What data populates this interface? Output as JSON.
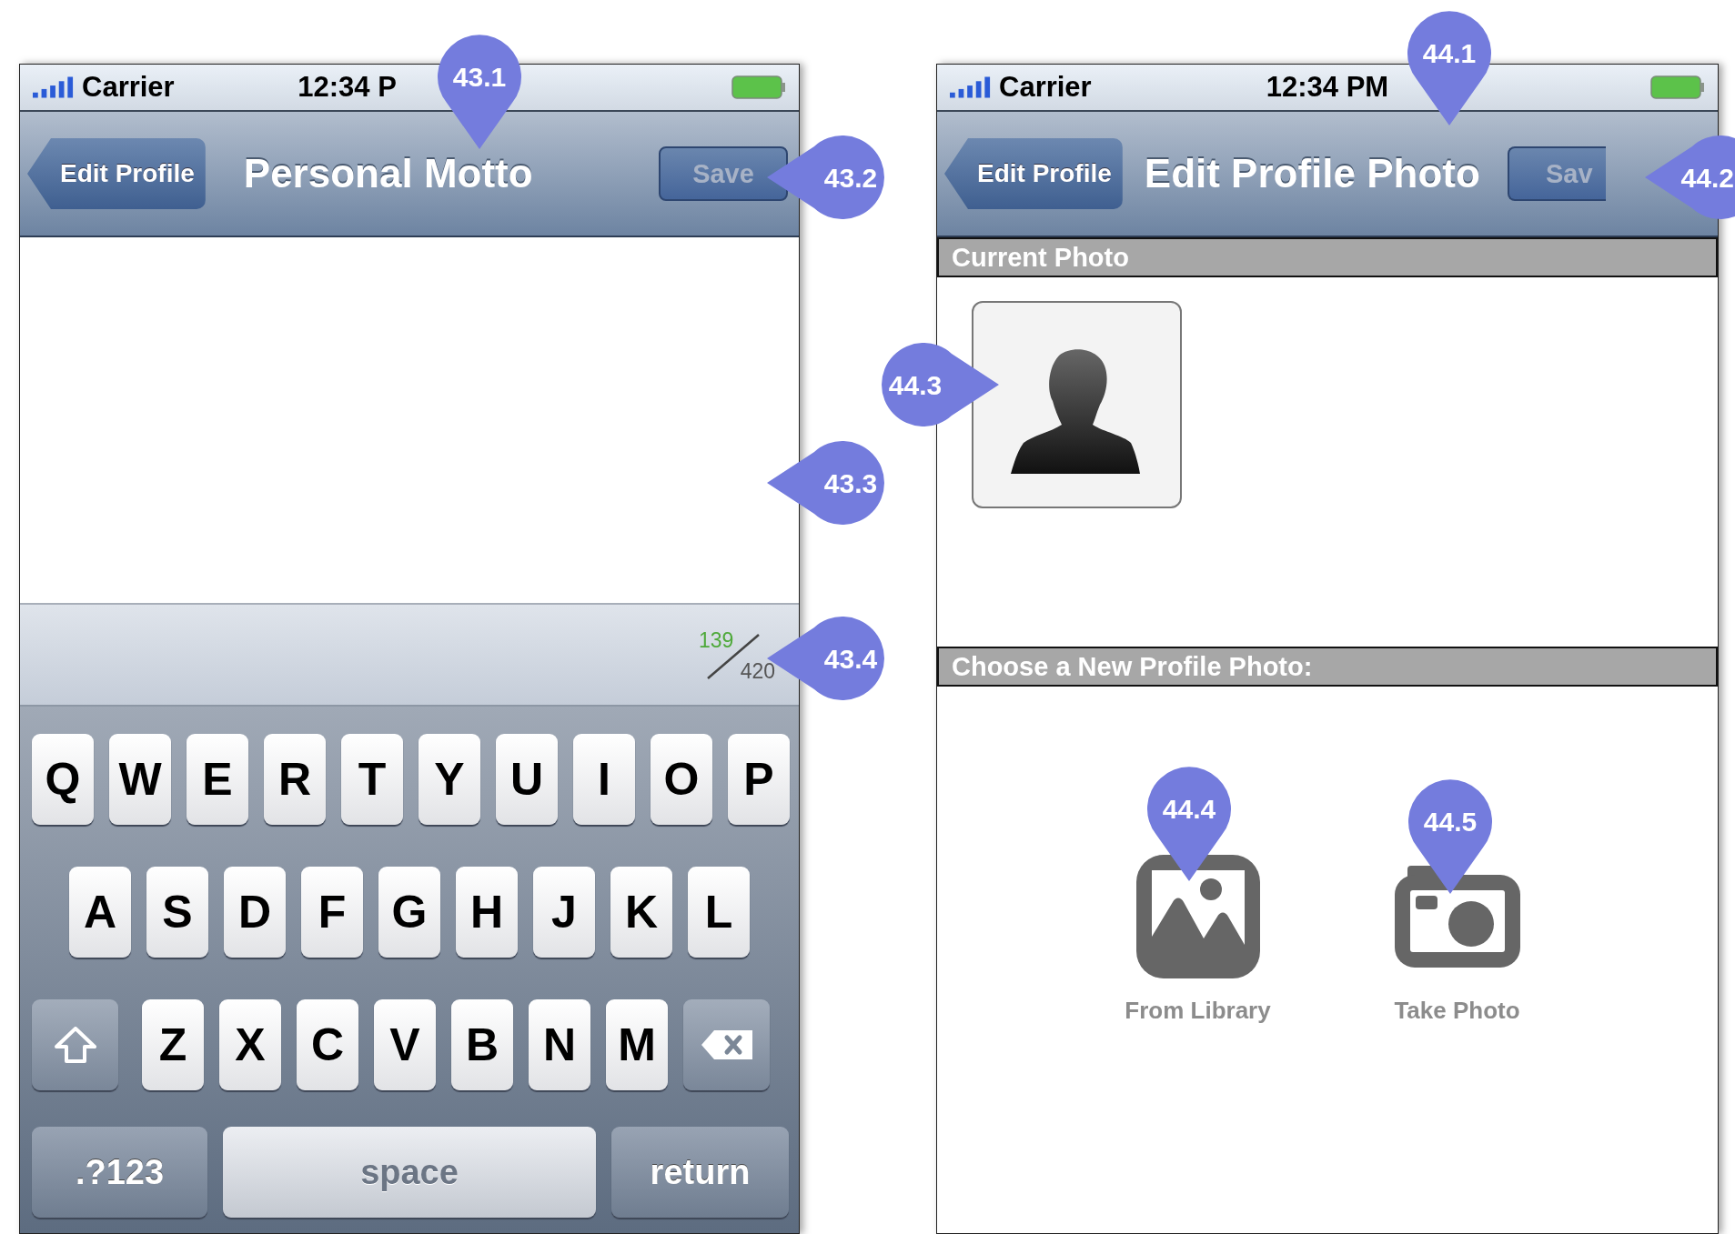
{
  "motto_screen": {
    "status_bar": {
      "carrier": "Carrier",
      "time": "12:34 P"
    },
    "nav_bar": {
      "back": "Edit Profile",
      "title": "Personal Motto",
      "action": {
        "label": "Save",
        "disabled": true
      }
    },
    "counter": {
      "used": "139",
      "limit": "420"
    },
    "keyboard": {
      "rows": [
        [
          "Q",
          "W",
          "E",
          "R",
          "T",
          "Y",
          "U",
          "I",
          "O",
          "P"
        ],
        [
          "A",
          "S",
          "D",
          "F",
          "G",
          "H",
          "J",
          "K",
          "L"
        ],
        [
          "Z",
          "X",
          "C",
          "V",
          "B",
          "N",
          "M"
        ]
      ],
      "bottom": [
        {
          "label": ".?123",
          "kind": "mode"
        },
        {
          "label": "space",
          "kind": "space"
        },
        {
          "label": "return",
          "kind": "return"
        }
      ]
    }
  },
  "photo_screen": {
    "status_bar": {
      "carrier": "Carrier",
      "time": "12:34 PM"
    },
    "nav_bar": {
      "back": "Edit Profile",
      "title": "Edit Profile Photo",
      "action": {
        "label": "Sav",
        "disabled": true
      }
    },
    "sections": [
      {
        "title": "Current Photo",
        "kind": "current"
      },
      {
        "title": "Choose a New Profile Photo:",
        "kind": "options"
      }
    ],
    "options": [
      {
        "label": "From Library",
        "kind": "library"
      },
      {
        "label": "Take Photo",
        "kind": "camera"
      }
    ]
  },
  "annotations": [
    {
      "label": "43.1",
      "kind": "down"
    },
    {
      "label": "43.2",
      "kind": "left"
    },
    {
      "label": "43.3",
      "kind": "left"
    },
    {
      "label": "43.4",
      "kind": "left"
    },
    {
      "label": "44.1",
      "kind": "down"
    },
    {
      "label": "44.2",
      "kind": "left"
    },
    {
      "label": "44.3",
      "kind": "right"
    },
    {
      "label": "44.4",
      "kind": "down"
    },
    {
      "label": "44.5",
      "kind": "down"
    }
  ]
}
